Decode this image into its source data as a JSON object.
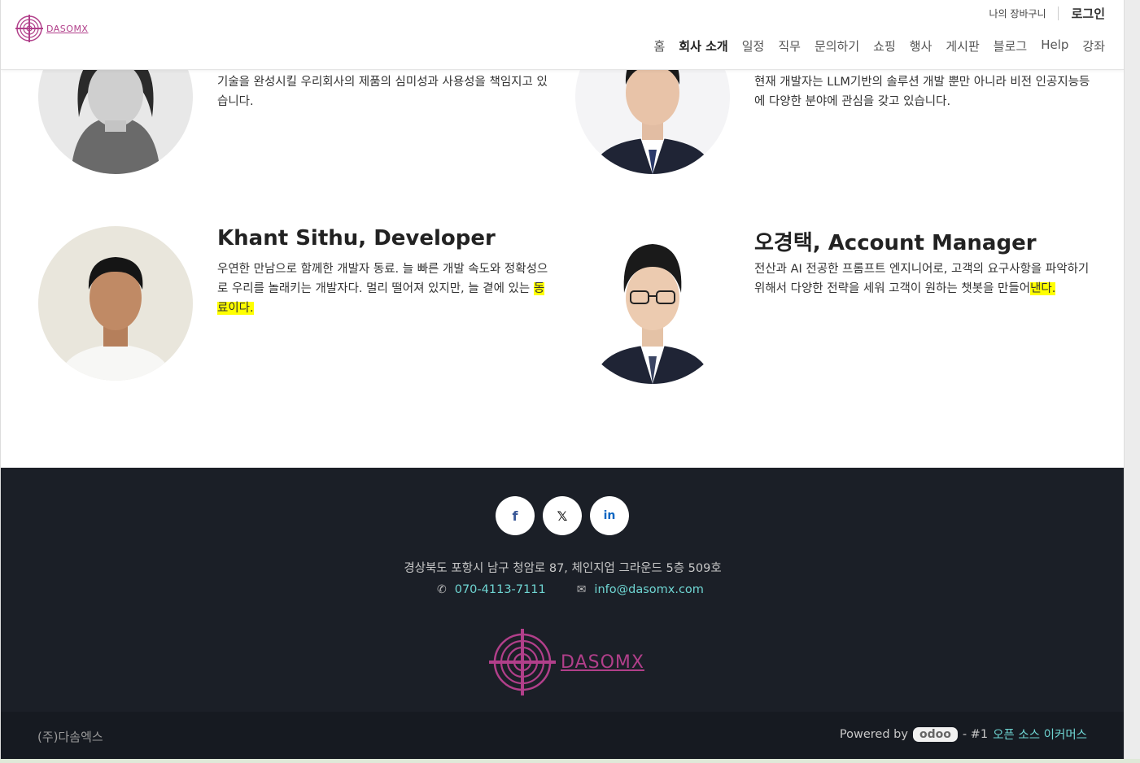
{
  "header": {
    "logo_text": "DASOMX",
    "cart_label": "나의 장바구니",
    "login_label": "로그인",
    "nav": [
      {
        "label": "홈",
        "active": false
      },
      {
        "label": "회사 소개",
        "active": true
      },
      {
        "label": "일정",
        "active": false
      },
      {
        "label": "직무",
        "active": false
      },
      {
        "label": "문의하기",
        "active": false
      },
      {
        "label": "쇼핑",
        "active": false
      },
      {
        "label": "행사",
        "active": false
      },
      {
        "label": "게시판",
        "active": false
      },
      {
        "label": "블로그",
        "active": false
      },
      {
        "label": "Help",
        "active": false
      },
      {
        "label": "강좌",
        "active": false
      }
    ]
  },
  "team": {
    "member1": {
      "bio": "기술을 완성시킬 우리회사의 제품의 심미성과 사용성을 책임지고 있습니다."
    },
    "member2": {
      "bio": "현재 개발자는 LLM기반의 솔루션 개발 뿐만 아니라 비전 인공지능등에 다양한 분야에 관심을 갖고 있습니다."
    },
    "member3": {
      "name": "Khant Sithu, Developer",
      "bio_main": "우연한 만남으로 함께한 개발자 동료. 늘 빠른 개발 속도와 정확성으로 우리를 놀래키는 개발자다. 멀리 떨어져 있지만, 늘 곁에 있는 ",
      "bio_highlight": "동료이다."
    },
    "member4": {
      "name": "오경택, Account Manager",
      "bio_main": " 전산과 AI 전공한 프롬프트 엔지니어로, 고객의 요구사항을 파악하기 위해서 다양한 전략을 세워 고객이 원하는 챗봇을 만들어",
      "bio_highlight": "낸다."
    }
  },
  "footer": {
    "social": [
      {
        "icon": "facebook-icon",
        "glyph": "f",
        "color": "#3b5998"
      },
      {
        "icon": "x-twitter-icon",
        "glyph": "𝕏",
        "color": "#111111"
      },
      {
        "icon": "linkedin-icon",
        "glyph": "in",
        "color": "#0a66c2"
      }
    ],
    "address": "경상북도 포항시 남구 청암로 87, 체인지업 그라운드 5층 509호",
    "phone": "070-4113-7111",
    "email": "info@dasomx.com",
    "logo_text": "DASOMX",
    "company": "(주)다솜엑스",
    "powered_by": "Powered by",
    "odoo": "odoo",
    "separator": "- #1",
    "ecommerce_link": "오픈 소스 이커머스"
  },
  "colors": {
    "brand": "#b13f8a",
    "footer_bg": "#1b1f27",
    "link": "#6fd6d3",
    "highlight": "#ffff00"
  }
}
